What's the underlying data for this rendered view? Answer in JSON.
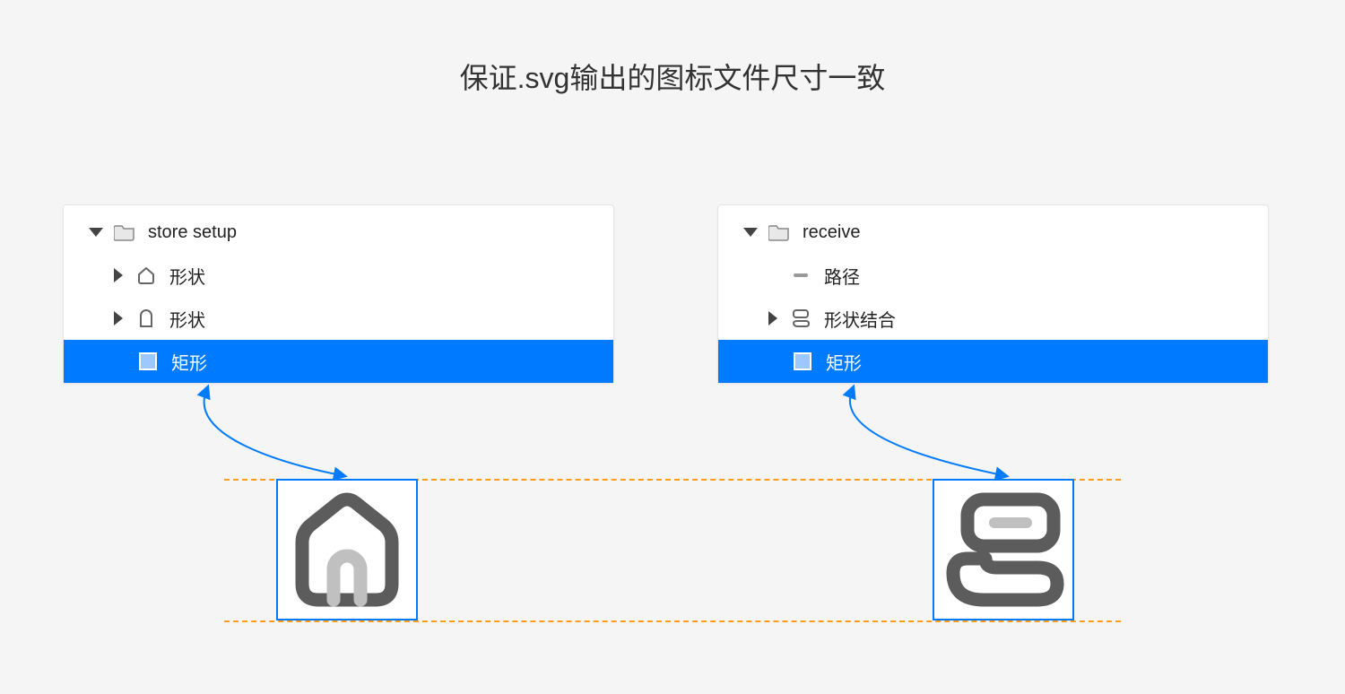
{
  "title": "保证.svg输出的图标文件尺寸一致",
  "panels": {
    "left": {
      "group_name": "store setup",
      "rows": [
        {
          "label": "形状",
          "icon": "house-outline"
        },
        {
          "label": "形状",
          "icon": "arch-outline"
        },
        {
          "label": "矩形",
          "icon": "rect-swatch",
          "selected": true
        }
      ]
    },
    "right": {
      "group_name": "receive",
      "rows": [
        {
          "label": "路径",
          "icon": "path-segment"
        },
        {
          "label": "形状结合",
          "icon": "combined-shape"
        },
        {
          "label": "矩形",
          "icon": "rect-swatch",
          "selected": true
        }
      ]
    }
  },
  "preview_icons": {
    "left": "home-icon",
    "right": "receive-icon"
  },
  "colors": {
    "selection": "#007aff",
    "guide": "#ff9c1a",
    "icon_dark": "#5c5c5c",
    "icon_light": "#c0c0c0"
  }
}
